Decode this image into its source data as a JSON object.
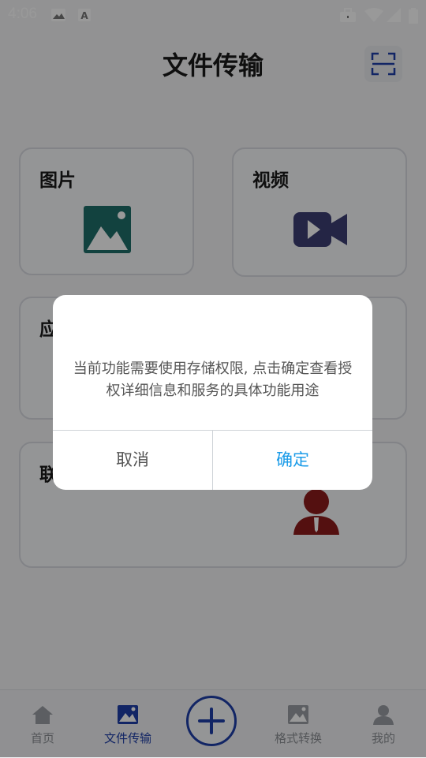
{
  "status_bar": {
    "time": "4:06",
    "icons": [
      "image-icon",
      "font-a-icon",
      "briefcase-icon",
      "wifi-icon",
      "signal-icon",
      "battery-icon"
    ]
  },
  "header": {
    "title": "文件传输",
    "scan_icon": "scan-icon"
  },
  "cards": [
    {
      "label": "图片",
      "icon": "image-icon",
      "color": "#1e6e6a"
    },
    {
      "label": "视频",
      "icon": "video-camera-icon",
      "color": "#3d3f73"
    },
    {
      "label": "应",
      "icon": "",
      "color": ""
    },
    {
      "label": "联",
      "icon": "contact-person-icon",
      "color": "#8c1c1c"
    }
  ],
  "bottom_nav": {
    "items": [
      {
        "label": "首页",
        "icon": "home-icon"
      },
      {
        "label": "文件传输",
        "icon": "image-icon",
        "active": true
      },
      {
        "label": "格式转换",
        "icon": "image-icon"
      },
      {
        "label": "我的",
        "icon": "user-icon"
      }
    ],
    "fab_icon": "plus-icon",
    "active_color": "#1e3fa8"
  },
  "dialog": {
    "message": "当前功能需要使用存储权限, 点击确定查看授权详细信息和服务的具体功能用途",
    "cancel_label": "取消",
    "confirm_label": "确定",
    "confirm_color": "#1a9be8"
  }
}
